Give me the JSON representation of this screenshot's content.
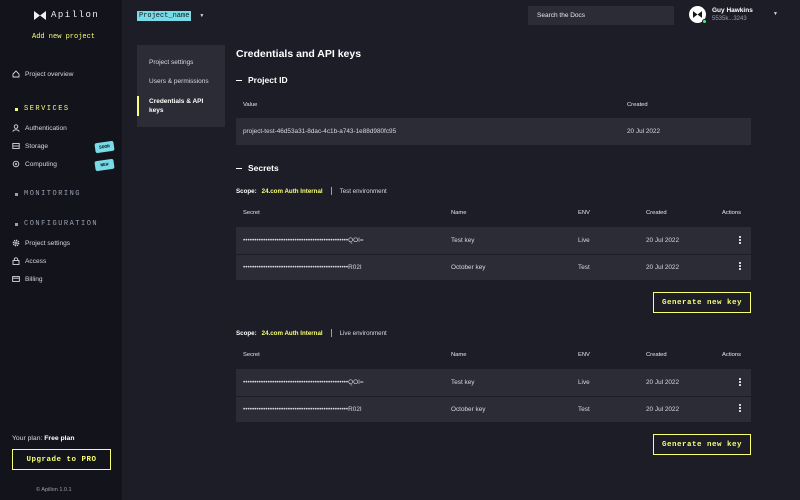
{
  "app": {
    "name": "Apillon",
    "add_project": "Add new project",
    "version": "© Apillon 1.0.1"
  },
  "sidebar": {
    "overview": "Project overview",
    "sections": [
      {
        "title": "SERVICES",
        "items": [
          {
            "label": "Authentication",
            "icon": "user-icon"
          },
          {
            "label": "Storage",
            "icon": "storage-icon",
            "badge": "SOON"
          },
          {
            "label": "Computing",
            "icon": "computing-icon",
            "badge": "NEW"
          }
        ]
      },
      {
        "title": "MONITORING",
        "items": []
      },
      {
        "title": "CONFIGURATION",
        "items": [
          {
            "label": "Project settings",
            "icon": "gear-icon"
          },
          {
            "label": "Access",
            "icon": "lock-icon"
          },
          {
            "label": "Billing",
            "icon": "card-icon"
          }
        ]
      }
    ],
    "plan_label": "Your plan:",
    "plan_value": "Free plan",
    "upgrade_label": "Upgrade to PRO"
  },
  "topbar": {
    "project_name": "Project_name",
    "search_placeholder": "Search the Docs",
    "user_name": "Guy Hawkins",
    "user_address": "5535k...3243"
  },
  "settings_nav": {
    "items": [
      {
        "label": "Project settings"
      },
      {
        "label": "Users & permissions"
      },
      {
        "label": "Credentials & API keys"
      }
    ]
  },
  "main": {
    "title": "Credentials and API keys",
    "project_id": {
      "heading": "Project ID",
      "col_value": "Value",
      "col_created": "Created",
      "value": "project-test-46d53a31-8dac-4c1b-a743-1e88d980fc95",
      "created": "20 Jul 2022"
    },
    "secrets": {
      "heading": "Secrets",
      "columns": {
        "secret": "Secret",
        "name": "Name",
        "env": "ENV",
        "created": "Created",
        "actions": "Actions"
      },
      "scope_label": "Scope:",
      "generate_label": "Generate new key",
      "groups": [
        {
          "scope_name": "24.com Auth Internal",
          "environment": "Test environment",
          "rows": [
            {
              "secret": "•••••••••••••••••••••••••••••••••••••••••••••••QOI=",
              "name": "Test key",
              "env": "Live",
              "created": "20 Jul 2022"
            },
            {
              "secret": "•••••••••••••••••••••••••••••••••••••••••••••••R02I",
              "name": "October key",
              "env": "Test",
              "created": "20 Jul 2022"
            }
          ]
        },
        {
          "scope_name": "24.com Auth Internal",
          "environment": "Live environment",
          "rows": [
            {
              "secret": "•••••••••••••••••••••••••••••••••••••••••••••••QOI=",
              "name": "Test key",
              "env": "Live",
              "created": "20 Jul 2022"
            },
            {
              "secret": "•••••••••••••••••••••••••••••••••••••••••••••••R02I",
              "name": "October key",
              "env": "Test",
              "created": "20 Jul 2022"
            }
          ]
        }
      ]
    }
  }
}
